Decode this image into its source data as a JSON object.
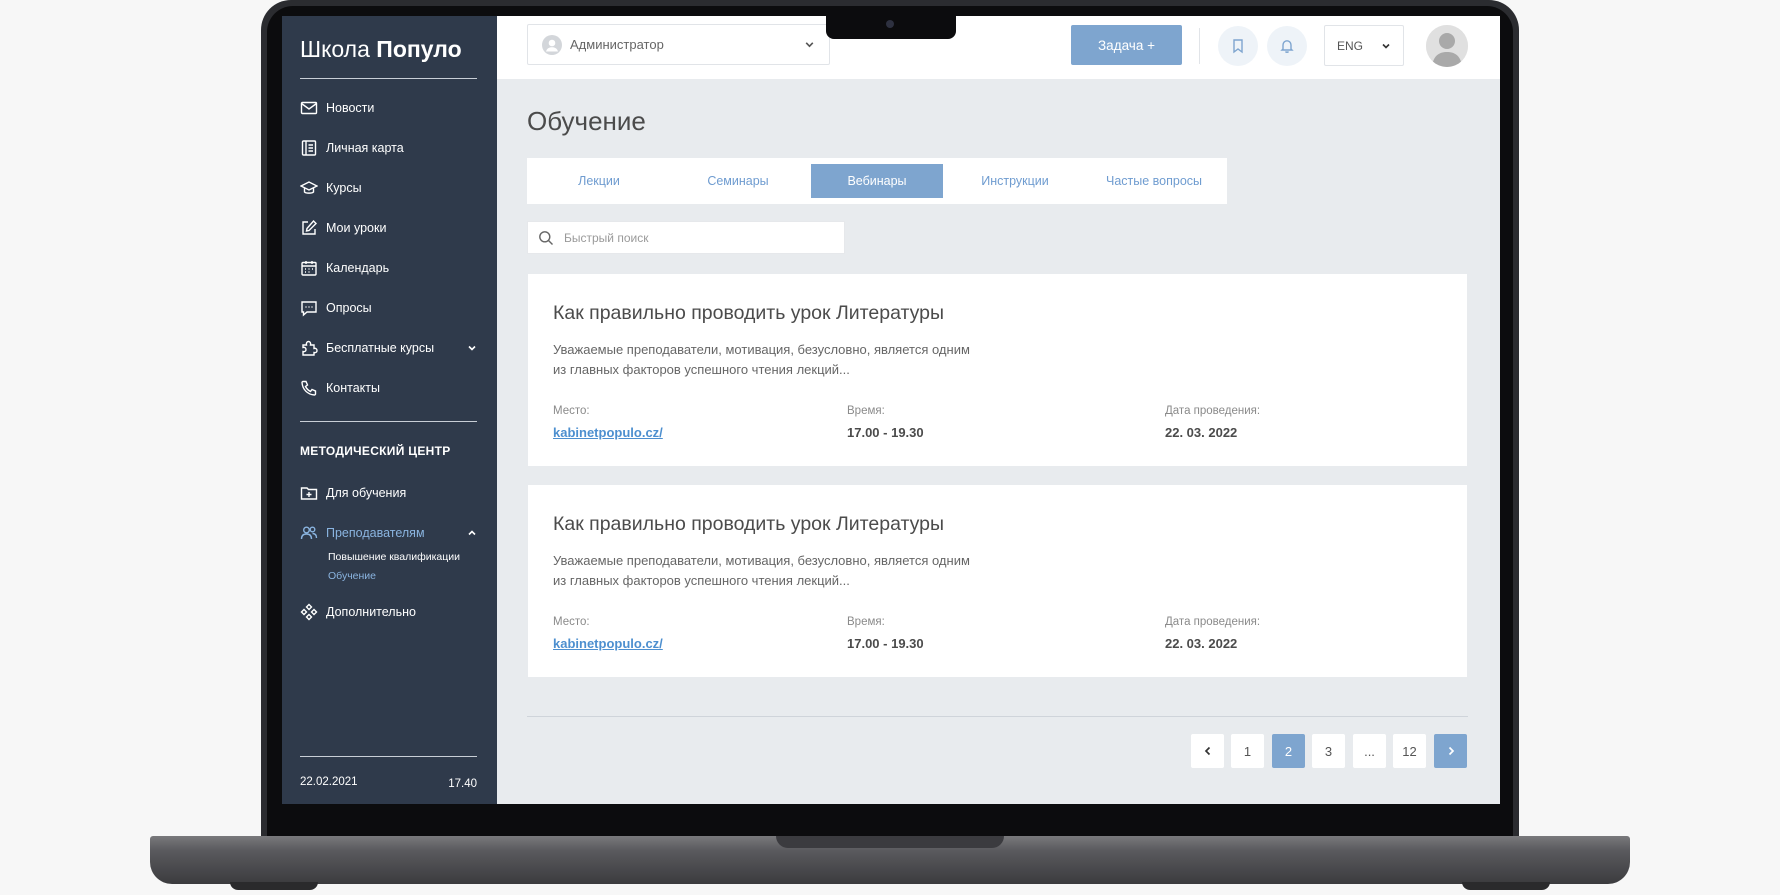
{
  "brand": {
    "name_light": "Школа",
    "name_bold": "Популо"
  },
  "sidebar": {
    "items": [
      {
        "label": "Новости",
        "icon": "mail-icon"
      },
      {
        "label": "Личная карта",
        "icon": "notebook-icon"
      },
      {
        "label": "Курсы",
        "icon": "graduation-cap-icon"
      },
      {
        "label": "Мои уроки",
        "icon": "edit-icon"
      },
      {
        "label": "Календарь",
        "icon": "calendar-icon"
      },
      {
        "label": "Опросы",
        "icon": "chat-icon"
      },
      {
        "label": "Бесплатные курсы",
        "icon": "puzzle-icon",
        "expandable": true
      },
      {
        "label": "Контакты",
        "icon": "phone-icon"
      }
    ],
    "section_title": "МЕТОДИЧЕСКИЙ ЦЕНТР",
    "section_items": [
      {
        "label": "Для обучения",
        "icon": "folder-plus-icon"
      },
      {
        "label": "Преподавателям",
        "icon": "users-icon",
        "expanded": true,
        "active": true,
        "subitems": [
          {
            "label": "Повышение квалификации"
          },
          {
            "label": "Обучение",
            "active": true
          }
        ]
      },
      {
        "label": "Дополнительно",
        "icon": "grid-diamond-icon"
      }
    ],
    "date": "22.02.2021",
    "time": "17.40"
  },
  "topbar": {
    "role": "Администратор",
    "task_button": "Задача +",
    "language": "ENG"
  },
  "main": {
    "title": "Обучение",
    "tabs": [
      {
        "label": "Лекции"
      },
      {
        "label": "Семинары"
      },
      {
        "label": "Вебинары",
        "active": true
      },
      {
        "label": "Инструкции"
      },
      {
        "label": "Частые вопросы"
      }
    ],
    "search": {
      "placeholder": "Быстрый поиск"
    },
    "cards": [
      {
        "title": "Как правильно проводить урок Литературы",
        "description": "Уважаемые преподаватели, мотивация, безусловно, является одним из главных факторов успешного чтения лекций...",
        "place_label": "Место:",
        "place": "kabinetpopulo.cz/",
        "time_label": "Время:",
        "time": "17.00 - 19.30",
        "date_label": "Дата проведения:",
        "date": "22. 03. 2022"
      },
      {
        "title": "Как правильно проводить урок Литературы",
        "description": "Уважаемые преподаватели, мотивация, безусловно, является одним из главных факторов успешного чтения лекций...",
        "place_label": "Место:",
        "place": "kabinetpopulo.cz/",
        "time_label": "Время:",
        "time": "17.00 - 19.30",
        "date_label": "Дата проведения:",
        "date": "22. 03. 2022"
      }
    ],
    "pagination": {
      "pages": [
        "1",
        "2",
        "3",
        "...",
        "12"
      ],
      "current": "2"
    }
  },
  "colors": {
    "sidebar_bg": "#2f3a4b",
    "accent": "#7ea5cf",
    "link": "#4d8fcf",
    "content_bg": "#e8ebee"
  }
}
